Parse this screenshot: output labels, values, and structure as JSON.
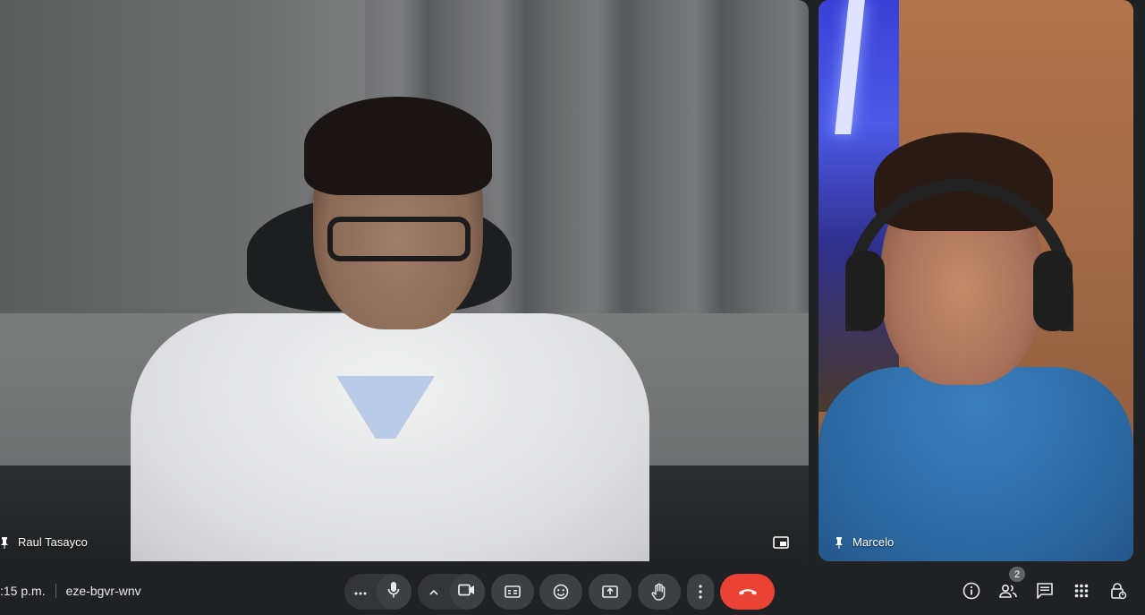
{
  "participants": [
    {
      "name": "Raul Tasayco"
    },
    {
      "name": "Marcelo"
    }
  ],
  "meeting": {
    "time": ":15 p.m.",
    "code": "eze-bgvr-wnv"
  },
  "controls": {
    "more_options_icon": "more-horizontal-icon",
    "mic_icon": "microphone-icon",
    "camera_icon": "videocam-icon",
    "captions_icon": "closed-captions-icon",
    "reactions_icon": "emoji-icon",
    "present_icon": "present-screen-icon",
    "raise_hand_icon": "hand-icon",
    "menu_icon": "more-vertical-icon",
    "end_call_icon": "call-end-icon",
    "end_call_color": "#ea4335"
  },
  "side_panel": {
    "people_count": "2"
  },
  "colors": {
    "background": "#202124",
    "button": "#3c4043"
  }
}
